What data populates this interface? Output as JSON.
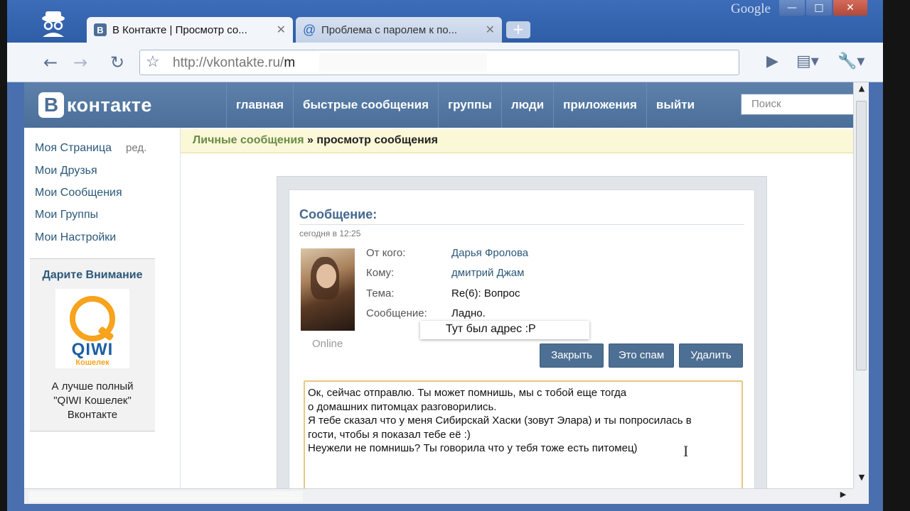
{
  "browser": {
    "branding": "Google",
    "tabs": [
      {
        "label": "В Контакте | Просмотр со...",
        "active": true
      },
      {
        "label": "Проблема с паролем к по...",
        "active": false
      }
    ],
    "url_host": "http://vkontakte.ru/",
    "url_path": "m",
    "window_controls": {
      "minimize": "—",
      "maximize": "□",
      "close": "✕"
    },
    "new_tab": "+"
  },
  "site": {
    "logo_letter": "В",
    "logo_text": "контакте",
    "nav": [
      "главная",
      "быстрые сообщения",
      "группы",
      "люди",
      "приложения",
      "выйти"
    ],
    "search_placeholder": "Поиск"
  },
  "sidebar": {
    "items": [
      "Моя Страница",
      "Мои Друзья",
      "Мои Сообщения",
      "Мои Группы",
      "Мои Настройки"
    ],
    "edit_label": "ред.",
    "ad": {
      "title": "Дарите Внимание",
      "logo_word": "QIWI",
      "logo_sub": "Кошелек",
      "text_lines": [
        "А лучше полный",
        "\"QIWI Кошелек\"",
        "Вконтакте"
      ]
    }
  },
  "breadcrumb": {
    "parent": "Личные сообщения",
    "separator": "»",
    "current": "просмотр сообщения"
  },
  "message": {
    "heading": "Сообщение:",
    "date": "сегодня в 12:25",
    "status": "Online",
    "fields": {
      "from_label": "От кого:",
      "from_value": "Дарья Фролова",
      "to_label": "Кому:",
      "to_value": "дмитрий Джам",
      "subject_label": "Тема:",
      "subject_value": "Re(6): Вопрос",
      "body_label": "Сообщение:",
      "body_value": "Ладно."
    },
    "overlay_note": "Тут был адрес :P",
    "buttons": {
      "close": "Закрыть",
      "spam": "Это спам",
      "delete": "Удалить"
    },
    "reply_lines": [
      "Ок, сейчас отправлю. Ты может помнишь, мы с тобой еще тогда",
      "о домашних питомцах разговорились.",
      "Я тебе сказал что у меня Сибирскай Хаски (зовут Элара) и ты попросилась в",
      "гости, чтобы я показал тебе её :)",
      "Неужели не помнишь? Ты говорила что у тебя тоже есть питомец)"
    ]
  },
  "colors": {
    "vk_header": "#4b6f99",
    "link": "#2b587a",
    "button": "#4d6f93",
    "breadcrumb_bg": "#fbf8d8",
    "chrome_frame": "#2f5ea8"
  },
  "icons": [
    "incognito-icon",
    "vk-favicon",
    "mail-at-icon",
    "back-arrow-icon",
    "forward-arrow-icon",
    "reload-icon",
    "star-icon",
    "go-arrow-icon",
    "page-menu-icon",
    "wrench-icon",
    "text-cursor-icon"
  ]
}
